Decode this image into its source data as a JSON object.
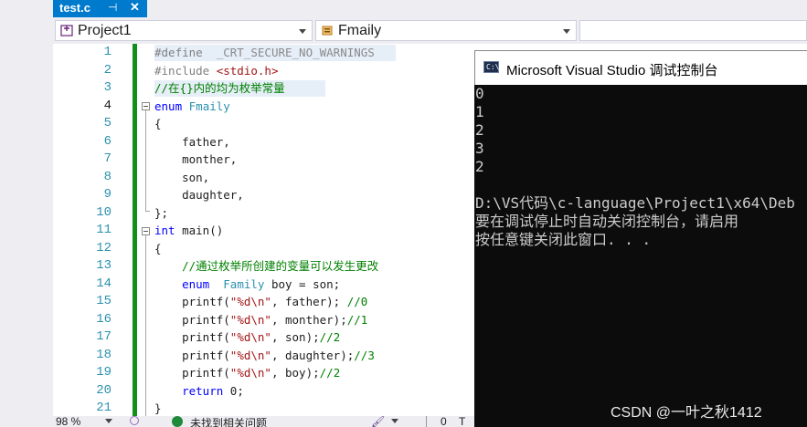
{
  "tab": {
    "title": "test.c",
    "pin_glyph": "⊣",
    "close_glyph": "✕"
  },
  "nav": {
    "project": "Project1",
    "scope": "Fmaily"
  },
  "editor": {
    "line_numbers": [
      "1",
      "2",
      "3",
      "4",
      "5",
      "6",
      "7",
      "8",
      "9",
      "10",
      "11",
      "12",
      "13",
      "14",
      "15",
      "16",
      "17",
      "18",
      "19",
      "20",
      "21"
    ],
    "lines": [
      [
        {
          "t": "#define  ",
          "c": "pp"
        },
        {
          "t": "_CRT_SECURE_NO_WARNINGS",
          "c": "macro"
        }
      ],
      [
        {
          "t": "#include ",
          "c": "pp"
        },
        {
          "t": "<stdio.h>",
          "c": "str"
        }
      ],
      [
        {
          "t": "//在{}内的均为枚举常量",
          "c": "cm"
        }
      ],
      [
        {
          "t": "enum ",
          "c": "kw"
        },
        {
          "t": "Fmaily",
          "c": "ty"
        }
      ],
      [
        {
          "t": "{",
          "c": "pl"
        }
      ],
      [
        {
          "t": "    father,",
          "c": "pl"
        }
      ],
      [
        {
          "t": "    monther,",
          "c": "pl"
        }
      ],
      [
        {
          "t": "    son,",
          "c": "pl"
        }
      ],
      [
        {
          "t": "    daughter,",
          "c": "pl"
        }
      ],
      [
        {
          "t": "};",
          "c": "pl"
        }
      ],
      [
        {
          "t": "int ",
          "c": "kw"
        },
        {
          "t": "main()",
          "c": "pl"
        }
      ],
      [
        {
          "t": "{",
          "c": "pl"
        }
      ],
      [
        {
          "t": "    //通过枚举所创建的变量可以发生更改",
          "c": "cm"
        }
      ],
      [
        {
          "t": "    enum  ",
          "c": "kw"
        },
        {
          "t": "Family ",
          "c": "ty"
        },
        {
          "t": "boy = son;",
          "c": "pl"
        }
      ],
      [
        {
          "t": "    printf(",
          "c": "pl"
        },
        {
          "t": "\"%d\\n\"",
          "c": "str"
        },
        {
          "t": ", father); ",
          "c": "pl"
        },
        {
          "t": "//0",
          "c": "cm"
        }
      ],
      [
        {
          "t": "    printf(",
          "c": "pl"
        },
        {
          "t": "\"%d\\n\"",
          "c": "str"
        },
        {
          "t": ", monther);",
          "c": "pl"
        },
        {
          "t": "//1",
          "c": "cm"
        }
      ],
      [
        {
          "t": "    printf(",
          "c": "pl"
        },
        {
          "t": "\"%d\\n\"",
          "c": "str"
        },
        {
          "t": ", son);",
          "c": "pl"
        },
        {
          "t": "//2",
          "c": "cm"
        }
      ],
      [
        {
          "t": "    printf(",
          "c": "pl"
        },
        {
          "t": "\"%d\\n\"",
          "c": "str"
        },
        {
          "t": ", daughter);",
          "c": "pl"
        },
        {
          "t": "//3",
          "c": "cm"
        }
      ],
      [
        {
          "t": "    printf(",
          "c": "pl"
        },
        {
          "t": "\"%d\\n\"",
          "c": "str"
        },
        {
          "t": ", boy);",
          "c": "pl"
        },
        {
          "t": "//2",
          "c": "cm"
        }
      ],
      [
        {
          "t": "    return ",
          "c": "kw"
        },
        {
          "t": "0;",
          "c": "pl"
        }
      ],
      [
        {
          "t": "}",
          "c": "pl"
        }
      ]
    ]
  },
  "status": {
    "zoom": "98 %",
    "issues": "未找到相关问题",
    "line_col": "0",
    "extra": "T"
  },
  "console": {
    "title": "Microsoft Visual Studio 调试控制台",
    "lines": [
      "0",
      "1",
      "2",
      "3",
      "2",
      "",
      "D:\\VS代码\\c-language\\Project1\\x64\\Deb",
      "要在调试停止时自动关闭控制台，请启用",
      "按任意键关闭此窗口. . ."
    ]
  },
  "watermark": "CSDN @一叶之秋1412",
  "colors": {
    "pp": "#808080",
    "macro": "#8a8a8a",
    "str": "#a31515",
    "cm": "#008000",
    "kw": "#0000ff",
    "ty": "#2b91af",
    "pl": "#1e1e1e",
    "accent": "#007acc"
  },
  "icons": {
    "project": "project-icon",
    "scope": "enum-icon",
    "console": "console-app-icon"
  }
}
